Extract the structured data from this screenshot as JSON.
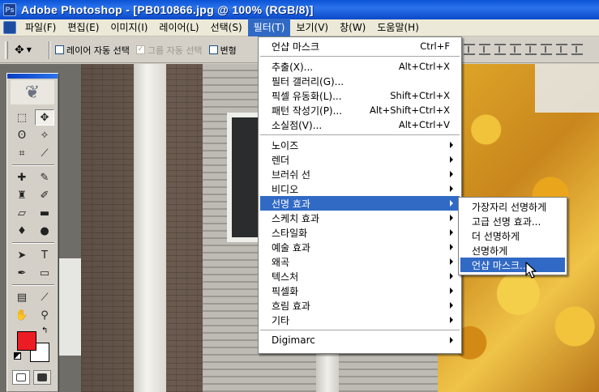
{
  "window": {
    "title": "Adobe Photoshop - [PB010866.jpg @ 100% (RGB/8)]",
    "app_icon": "Ps"
  },
  "menubar": {
    "items": [
      {
        "label": "파일(F)"
      },
      {
        "label": "편집(E)"
      },
      {
        "label": "이미지(I)"
      },
      {
        "label": "레이어(L)"
      },
      {
        "label": "선택(S)"
      },
      {
        "label": "필터(T)",
        "active": true
      },
      {
        "label": "보기(V)"
      },
      {
        "label": "창(W)"
      },
      {
        "label": "도움말(H)"
      }
    ]
  },
  "options_bar": {
    "tool_icon": "move-tool-icon",
    "auto_select_layer": {
      "label": "레이어 자동 선택",
      "checked": false
    },
    "auto_select_group": {
      "label": "그룹 자동 선택",
      "checked": true,
      "disabled": true
    },
    "transform_controls": {
      "label": "변형",
      "checked": false
    }
  },
  "filter_menu": {
    "items": [
      {
        "label": "언샵 마스크",
        "shortcut": "Ctrl+F"
      },
      {
        "separator": true
      },
      {
        "label": "추출(X)...",
        "shortcut": "Alt+Ctrl+X"
      },
      {
        "label": "필터 갤러리(G)...",
        "shortcut": ""
      },
      {
        "label": "픽셀 유동화(L)...",
        "shortcut": "Shift+Ctrl+X"
      },
      {
        "label": "패턴 작성기(P)...",
        "shortcut": "Alt+Shift+Ctrl+X"
      },
      {
        "label": "소실점(V)...",
        "shortcut": "Alt+Ctrl+V"
      },
      {
        "separator": true
      },
      {
        "label": "노이즈",
        "submenu": true
      },
      {
        "label": "렌더",
        "submenu": true
      },
      {
        "label": "브러쉬 선",
        "submenu": true
      },
      {
        "label": "비디오",
        "submenu": true
      },
      {
        "label": "선명 효과",
        "submenu": true,
        "highlighted": true
      },
      {
        "label": "스케치 효과",
        "submenu": true
      },
      {
        "label": "스타일화",
        "submenu": true
      },
      {
        "label": "예술 효과",
        "submenu": true
      },
      {
        "label": "왜곡",
        "submenu": true
      },
      {
        "label": "텍스처",
        "submenu": true
      },
      {
        "label": "픽셀화",
        "submenu": true
      },
      {
        "label": "흐림 효과",
        "submenu": true
      },
      {
        "label": "기타",
        "submenu": true
      },
      {
        "separator": true
      },
      {
        "label": "Digimarc",
        "submenu": true
      }
    ]
  },
  "sharpen_submenu": {
    "items": [
      {
        "label": "가장자리 선명하게"
      },
      {
        "label": "고급 선명 효과..."
      },
      {
        "label": "더 선명하게"
      },
      {
        "label": "선명하게"
      },
      {
        "label": "언샵 마스크...",
        "highlighted": true
      }
    ]
  },
  "toolbox": {
    "foreground_color": "#ec1c24",
    "background_color": "#ffffff"
  },
  "colors": {
    "menu_highlight": "#316ac5",
    "title_bar": "#0a53d6"
  }
}
